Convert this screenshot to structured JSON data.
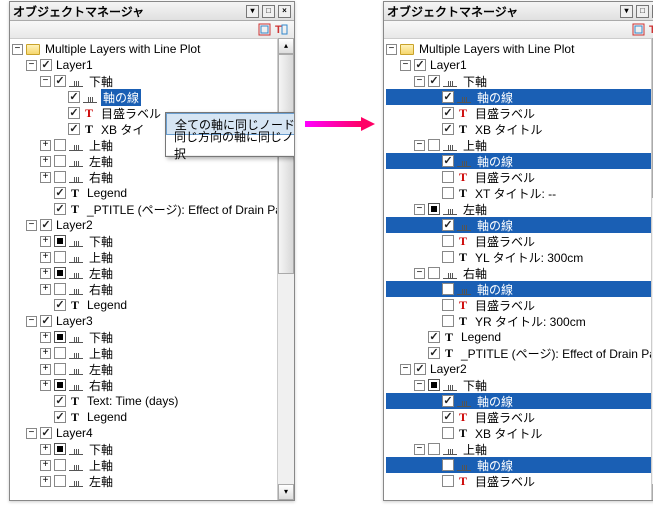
{
  "title": "オブジェクトマネージャ",
  "root": "Multiple Layers with Line Plot",
  "ctx": {
    "a": "全ての軸に同じノードを選択",
    "b": "同じ方向の軸に同じノードを選択"
  },
  "left": {
    "layer1": "Layer1",
    "bottom": "下軸",
    "axisline": "軸の線",
    "ticklabel": "目盛ラベル",
    "xbtitle": "XB タイ",
    "top": "上軸",
    "leftax": "左軸",
    "rightax": "右軸",
    "legend": "Legend",
    "ptitle": "_PTITLE (ページ): Effect of Drain Pa",
    "layer2": "Layer2",
    "layer3": "Layer3",
    "text_time": "Text: Time (days)",
    "layer4": "Layer4"
  },
  "right": {
    "ticklabel": "目盛ラベル",
    "xbtitle": "XB タイトル",
    "topax": "上軸",
    "axisline": "軸の線",
    "xttitle": "XT タイトル: --",
    "leftax": "左軸",
    "yltitle": "YL タイトル: 300cm",
    "rightax": "右軸",
    "yrtitle": "YR タイトル: 300cm",
    "legend": "Legend",
    "ptitle": "_PTITLE (ページ): Effect of Drain Pa",
    "layer2": "Layer2",
    "bottom": "下軸"
  }
}
